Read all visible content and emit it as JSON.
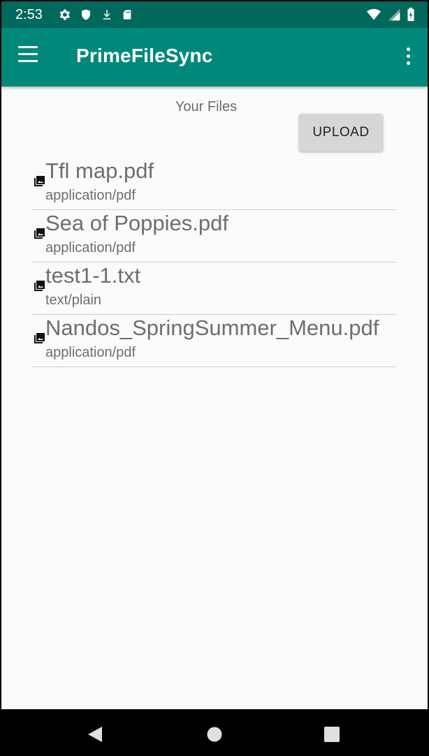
{
  "status_bar": {
    "time": "2:53",
    "left_icons": [
      "gear-icon",
      "shield-icon",
      "download-icon",
      "sd-card-icon"
    ],
    "right_icons": [
      "wifi-icon",
      "signal-icon",
      "battery-icon"
    ]
  },
  "app_bar": {
    "title": "PrimeFileSync",
    "background": "#00897b",
    "status_background": "#00695c"
  },
  "main": {
    "section_title": "Your Files",
    "upload_label": "UPLOAD",
    "files": [
      {
        "name": "Tfl map.pdf",
        "type": "application/pdf",
        "icon": "image-icon"
      },
      {
        "name": "Sea of Poppies.pdf",
        "type": "application/pdf",
        "icon": "image-icon"
      },
      {
        "name": "test1-1.txt",
        "type": "text/plain",
        "icon": "image-icon"
      },
      {
        "name": "Nandos_SpringSummer_Menu.pdf",
        "type": "application/pdf",
        "icon": "image-icon"
      }
    ]
  },
  "nav_bar": {
    "buttons": [
      "back-icon",
      "home-icon",
      "recents-icon"
    ]
  }
}
